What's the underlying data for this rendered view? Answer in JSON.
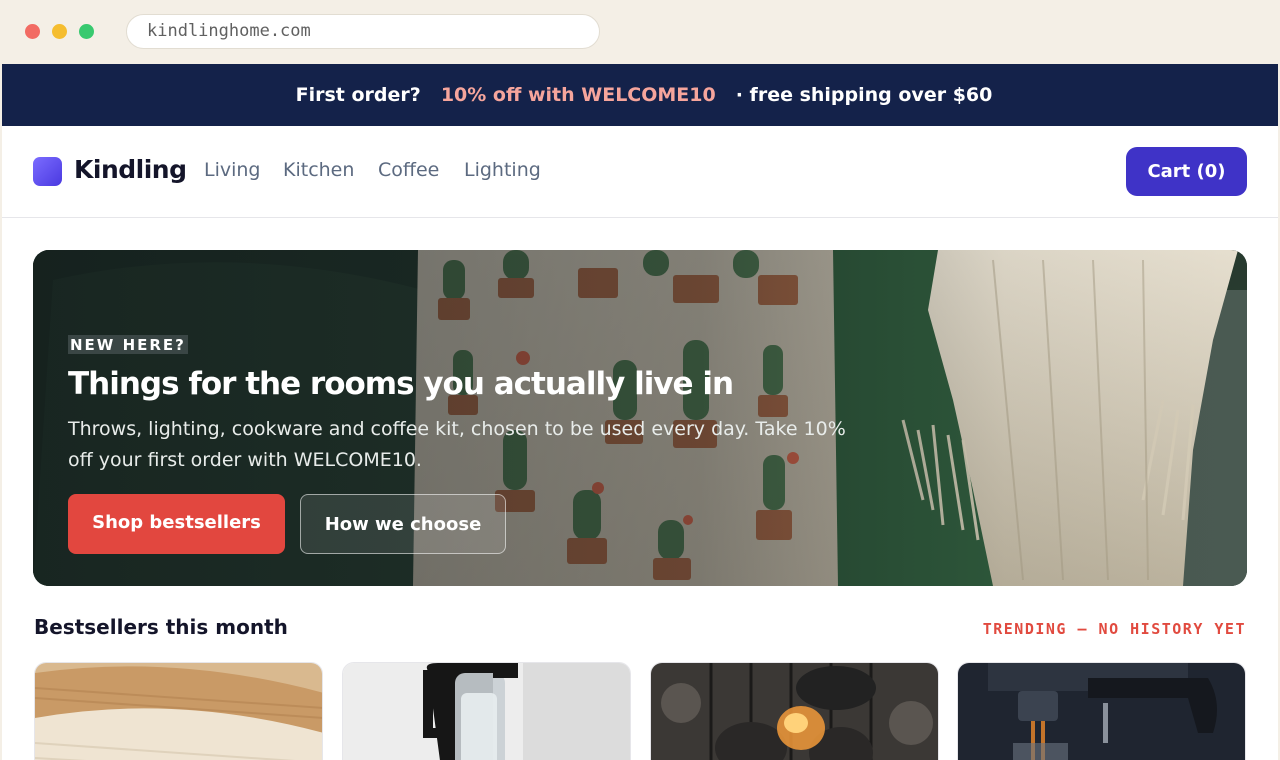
{
  "browser": {
    "url": "kindlinghome.com"
  },
  "promo": {
    "lead": "First order?",
    "offer": "10% off with WELCOME10",
    "shipping": "· free shipping over $60",
    "offer_color": "#f6a59c",
    "background": "#14224a"
  },
  "header": {
    "brand": "Kindling",
    "nav": [
      {
        "label": "Living"
      },
      {
        "label": "Kitchen"
      },
      {
        "label": "Coffee"
      },
      {
        "label": "Lighting"
      }
    ],
    "cart_label": "Cart (0)",
    "accent": "#3f33c7"
  },
  "hero": {
    "eyebrow": "NEW HERE?",
    "title": "Things for the rooms you actually live in",
    "subtitle": "Throws, lighting, cookware and coffee kit, chosen to be used every day. Take 10% off your first order with WELCOME10.",
    "primary_cta": "Shop bestsellers",
    "secondary_cta": "How we choose",
    "primary_color": "#e2473f"
  },
  "bestsellers": {
    "title": "Bestsellers this month",
    "tag": "TRENDING — NO HISTORY YET",
    "tag_color": "#e14a3f",
    "products": [
      {
        "image": "knit-throw"
      },
      {
        "image": "glass-kettle"
      },
      {
        "image": "cast-iron-over-fire"
      },
      {
        "image": "espresso-machine"
      }
    ]
  }
}
